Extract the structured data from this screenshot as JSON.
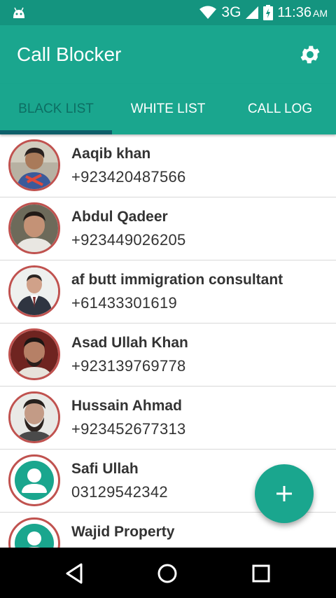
{
  "status_bar": {
    "network": "3G",
    "time": "11:36",
    "ampm": "AM"
  },
  "app_bar": {
    "title": "Call Blocker",
    "settings_icon": "gear-icon"
  },
  "tabs": [
    {
      "label": "BLACK LIST",
      "active": true
    },
    {
      "label": "WHITE LIST",
      "active": false
    },
    {
      "label": "CALL LOG",
      "active": false
    }
  ],
  "contacts": [
    {
      "name": "Aaqib khan",
      "phone": "+923420487566",
      "avatar": "photo"
    },
    {
      "name": "Abdul Qadeer",
      "phone": "+923449026205",
      "avatar": "photo"
    },
    {
      "name": "af butt immigration consultant",
      "phone": "+61433301619",
      "avatar": "photo"
    },
    {
      "name": "Asad Ullah Khan",
      "phone": "+923139769778",
      "avatar": "photo"
    },
    {
      "name": "Hussain Ahmad",
      "phone": "+923452677313",
      "avatar": "photo"
    },
    {
      "name": "Safi Ullah",
      "phone": "03129542342",
      "avatar": "default-person-icon"
    },
    {
      "name": "Wajid Property",
      "phone": "",
      "avatar": "default-person-icon"
    }
  ],
  "fab": {
    "icon": "plus-icon"
  },
  "nav_bar": {
    "back": "back-icon",
    "home": "home-icon",
    "recents": "recents-icon"
  },
  "colors": {
    "primary": "#1aa68e",
    "status_bar": "#14947f",
    "active_tab_text": "#0d6e63",
    "tab_indicator": "#0d5f6a",
    "avatar_border": "#c0524f"
  }
}
